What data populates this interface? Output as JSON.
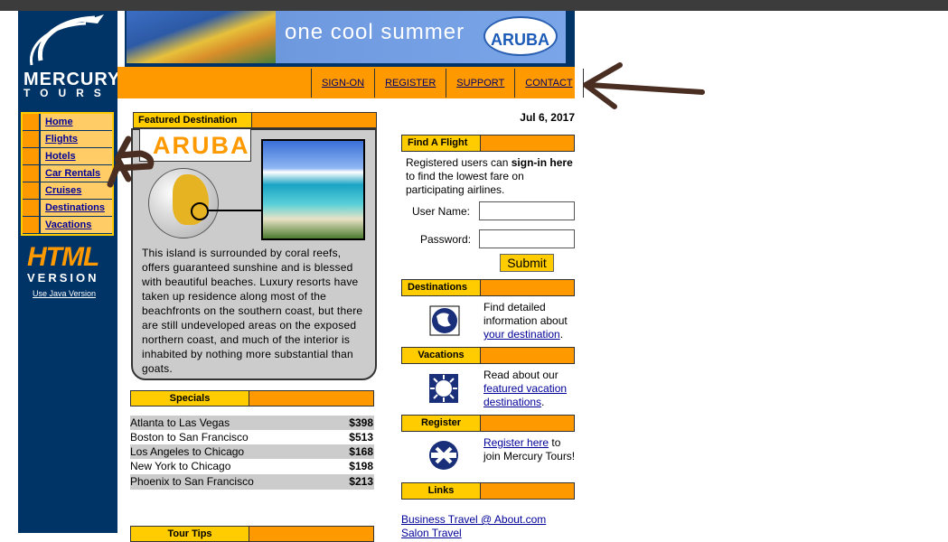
{
  "brand": {
    "name": "MERCURY",
    "tagline": "TOURS"
  },
  "banner": {
    "text": "one cool summer",
    "badge": "ARUBA"
  },
  "top_nav": [
    "SIGN-ON",
    "REGISTER",
    "SUPPORT",
    "CONTACT"
  ],
  "side_nav": [
    "Home",
    "Flights",
    "Hotels",
    "Car Rentals",
    "Cruises",
    "Destinations",
    "Vacations"
  ],
  "html_version": {
    "line1": "HTML",
    "line2": "VERSION",
    "java_link": "Use Java Version"
  },
  "featured": {
    "header": "Featured Destination",
    "name": "ARUBA",
    "description": "This island is surrounded by coral reefs, offers guaranteed sunshine and is blessed with beautiful beaches. Luxury resorts have taken up residence along most of the beachfronts on the southern coast, but there are still undeveloped areas on the exposed northern coast, and much of the interior is inhabited by nothing more substantial than goats."
  },
  "specials": {
    "header": "Specials",
    "rows": [
      {
        "route": "Atlanta to Las Vegas",
        "price": "$398"
      },
      {
        "route": "Boston to San Francisco",
        "price": "$513"
      },
      {
        "route": "Los Angeles to Chicago",
        "price": "$168"
      },
      {
        "route": "New York to Chicago",
        "price": "$198"
      },
      {
        "route": "Phoenix to San Francisco",
        "price": "$213"
      }
    ]
  },
  "tour_tips": {
    "header": "Tour Tips"
  },
  "date": "Jul 6, 2017",
  "find_flight": {
    "header": "Find A Flight",
    "text_pre": "Registered users can ",
    "text_bold": "sign-in here",
    "text_post": " to find the lowest fare on participating airlines.",
    "username_label": "User Name:",
    "password_label": "Password:",
    "submit": "Submit"
  },
  "destinations": {
    "header": "Destinations",
    "text": "Find detailed information about ",
    "link": "your destination",
    "tail": "."
  },
  "vacations": {
    "header": "Vacations",
    "text": "Read about our ",
    "link": "featured vacation destinations",
    "tail": "."
  },
  "register": {
    "header": "Register",
    "link": "Register here",
    "text": " to join Mercury Tours!"
  },
  "links": {
    "header": "Links",
    "items": [
      "Business Travel @ About.com",
      "Salon Travel"
    ]
  },
  "colors": {
    "navy": "#003366",
    "orange": "#ff9900",
    "yellow": "#ffcc00",
    "annotation_brown": "#4a2e22"
  }
}
